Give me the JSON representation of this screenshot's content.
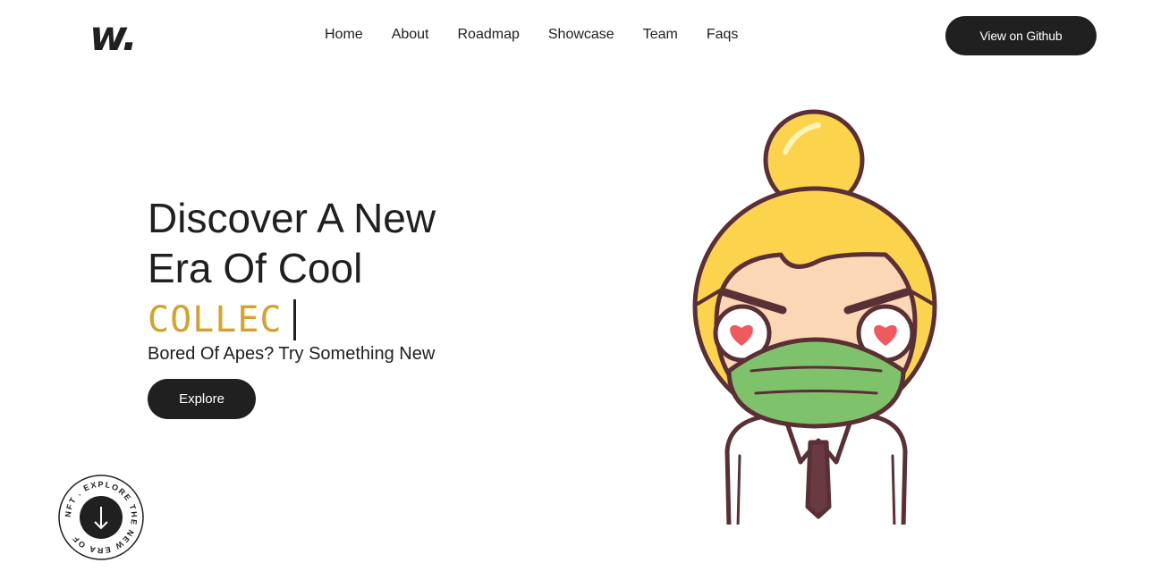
{
  "brand": {
    "logo_text": "w."
  },
  "nav": {
    "items": [
      {
        "label": "Home"
      },
      {
        "label": "About"
      },
      {
        "label": "Roadmap"
      },
      {
        "label": "Showcase"
      },
      {
        "label": "Team"
      },
      {
        "label": "Faqs"
      }
    ],
    "github_button": "View on Github"
  },
  "hero": {
    "title_line1": "Discover A New",
    "title_line2": "Era Of Cool",
    "typed_text": "COLLEC",
    "subtitle": "Bored Of Apes? Try Something New",
    "explore_button": "Explore"
  },
  "badge": {
    "ring_text": "NFT . EXPLORE THE NEW ERA OF",
    "arrow_icon": "arrow-down-icon"
  },
  "colors": {
    "primary_dark": "#202020",
    "accent_gold": "#d5a22b",
    "background": "#ffffff"
  }
}
